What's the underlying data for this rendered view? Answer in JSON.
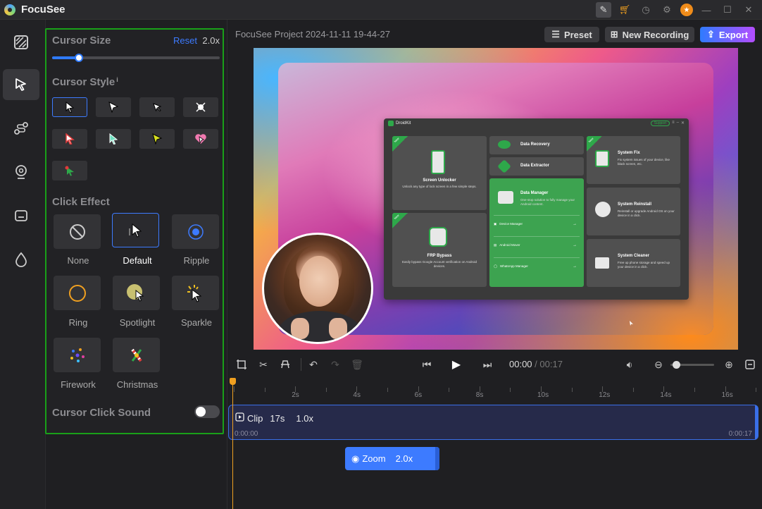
{
  "app": {
    "name": "FocuSee"
  },
  "titlebar": {
    "icons": [
      "edit-icon",
      "cart-icon",
      "history-icon",
      "settings-icon",
      "promo-icon",
      "minimize-icon",
      "maximize-icon",
      "close-icon"
    ]
  },
  "rail": {
    "items": [
      "layout-icon",
      "cursor-icon",
      "path-icon",
      "camera-icon",
      "caption-icon",
      "color-icon"
    ],
    "selected": "cursor-icon"
  },
  "cursor_size": {
    "title": "Cursor Size",
    "reset_label": "Reset",
    "value": "2.0x",
    "level": 0.16
  },
  "cursor_style": {
    "title": "Cursor Style",
    "info": "i",
    "selected": 0
  },
  "click_effect": {
    "title": "Click Effect",
    "items": [
      {
        "label": "None"
      },
      {
        "label": "Default"
      },
      {
        "label": "Ripple"
      },
      {
        "label": "Ring"
      },
      {
        "label": "Spotlight"
      },
      {
        "label": "Sparkle"
      },
      {
        "label": "Firework"
      },
      {
        "label": "Christmas"
      }
    ],
    "selected": "Default"
  },
  "click_sound": {
    "title": "Cursor Click Sound",
    "enabled": false
  },
  "header": {
    "project_title": "FocuSee Project 2024-11-11 19-44-27",
    "preset_label": "Preset",
    "new_recording_label": "New Recording",
    "export_label": "Export"
  },
  "droidkit": {
    "title": "DroidKit",
    "support": "Support",
    "new_tag": "New",
    "screen_unlocker": {
      "title": "Screen Unlocker",
      "desc": "Unlock any type of lock screen in a few simple steps."
    },
    "frp_bypass": {
      "title": "FRP Bypass",
      "desc": "Easily bypass Google Account verification on Android devices."
    },
    "data_recovery": {
      "title": "Data Recovery"
    },
    "data_extractor": {
      "title": "Data Extractor"
    },
    "data_manager": {
      "title": "Data Manager",
      "desc": "One-stop solution to fully manage your Android content.",
      "rows": [
        "Device Manager",
        "Android Mover",
        "WhatsApp Manager"
      ]
    },
    "system_fix": {
      "title": "System Fix",
      "desc": "Fix system issues of your device, like black screen, etc."
    },
    "system_reinstall": {
      "title": "System Reinstall",
      "desc": "Reinstall or upgrade Android OS on your device in a click."
    },
    "system_cleaner": {
      "title": "System Cleaner",
      "desc": "Free up phone storage and speed up your device in a click."
    }
  },
  "player": {
    "current": "00:00",
    "separator": "/",
    "total": "00:17",
    "zoom_level": 0.05
  },
  "timeline": {
    "ticks": [
      "2s",
      "4s",
      "6s",
      "8s",
      "10s",
      "12s",
      "14s",
      "16s"
    ],
    "clip": {
      "label": "Clip",
      "duration": "17s",
      "speed": "1.0x",
      "start": "0:00:00",
      "end": "0:00:17"
    },
    "zoom": {
      "label": "Zoom",
      "value": "2.0x"
    }
  },
  "colors": {
    "accent": "#3d7bff",
    "highlight": "#19a019",
    "export_gradient": [
      "#2f7bff",
      "#b44dff"
    ],
    "playhead": "#f0a020"
  }
}
